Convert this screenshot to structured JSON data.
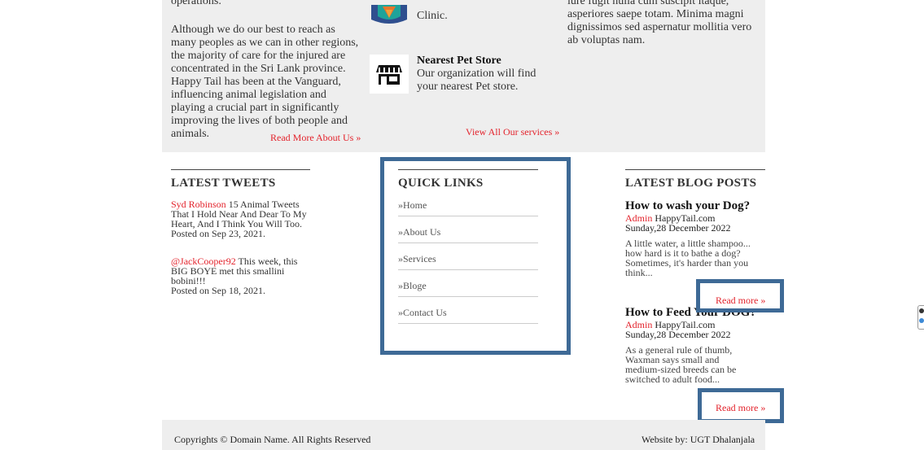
{
  "about": {
    "fragment": "operations.",
    "paragraph": "Although we do our best to reach as many peoples as we can in other regions, the majority of care for the injured are concentrated in the Sri Lank province. Happy Tail has been at the Vanguard, influencing animal legislation and playing a crucial part in significantly improving the lives of both people and animals.",
    "read_more": "Read More About Us »"
  },
  "services": {
    "clinic_fragment": "Clinic.",
    "store_title": "Nearest Pet Store",
    "store_desc": "Our organization will find your nearest Pet store.",
    "view_all": "View All Our services »"
  },
  "lorem": {
    "fragment": "iure fugit nulla cum suscipit itaque, asperiores saepe totam. Minima magni dignissimos sed aspernatur mollitia vero ab voluptas nam."
  },
  "tweets": {
    "title": "LATEST TWEETS",
    "items": [
      {
        "author": "Syd Robinson",
        "text": " 15 Animal Tweets That I Hold Near And Dear To My Heart, And I Think You Will Too.",
        "posted": "Posted on Sep 23, 2021."
      },
      {
        "author": "@JackCooper92",
        "text": " This week, this BIG BOYE met this smallini bobini!!!",
        "posted": "Posted on Sep 18, 2021."
      }
    ]
  },
  "quick_links": {
    "title": "QUICK LINKS",
    "items": [
      "»Home",
      "»About Us",
      "»Services",
      "»Bloge",
      "»Contact Us"
    ]
  },
  "blog": {
    "title": "LATEST BLOG POSTS",
    "posts": [
      {
        "title": "How to wash your Dog?",
        "author": "Admin",
        "site": " HappyTail.com",
        "date": "Sunday,28 December 2022",
        "excerpt": "A little water, a little shampoo... how hard is it to bathe a dog? Sometimes, it's harder than you think...",
        "read_more": "Read more »"
      },
      {
        "title": "How to Feed Your DOG?",
        "author": "Admin",
        "site": " HappyTail.com",
        "date": "Sunday,28 December 2022",
        "excerpt": "As a general rule of thumb, Waxman says small and medium-sized breeds can be switched to adult food...",
        "read_more": "Read more »"
      }
    ]
  },
  "footer": {
    "copyright": "Copyrights © Domain Name. All Rights Reserved",
    "credit": "Website by: UGT Dhalanjala"
  },
  "colors": {
    "highlight": "#3e6a96",
    "accent_red": "#e3232c",
    "panel_gray": "#eeeeee"
  },
  "icons": {
    "clinic": "clinic-logo-icon",
    "store": "store-icon"
  }
}
